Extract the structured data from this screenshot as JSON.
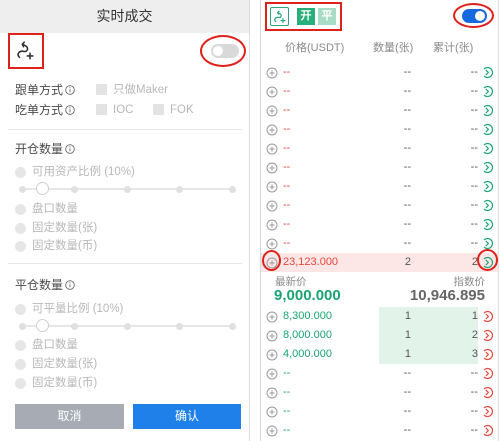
{
  "colors": {
    "accent": "#1e80e8",
    "buy": "#1aa471",
    "sell": "#e8463c",
    "annotation": "#e0201a"
  },
  "left_panel": {
    "title": "实时成交",
    "follow_icon": "follow-trade-icon",
    "follow_toggle_on": false,
    "follow_mode": {
      "label": "跟单方式",
      "option": "只做Maker"
    },
    "take_mode": {
      "label": "吃单方式",
      "options": [
        "IOC",
        "FOK"
      ]
    },
    "open_qty": {
      "title": "开仓数量",
      "ratio_label": "可用资产比例 (10%)",
      "slider_percent": 10,
      "options": [
        "盘口数量",
        "固定数量(张)",
        "固定数量(币)"
      ]
    },
    "close_qty": {
      "title": "平仓数量",
      "ratio_label": "可平量比例 (10%)",
      "slider_percent": 10,
      "options": [
        "盘口数量",
        "固定数量(张)",
        "固定数量(币)"
      ]
    },
    "buttons": {
      "cancel": "取消",
      "confirm": "确认"
    }
  },
  "right_panel": {
    "follow_icon": "follow-trade-icon",
    "open_label": "开",
    "close_label": "平",
    "toggle_on": true,
    "columns": {
      "price": "价格(USDT)",
      "qty": "数量(张)",
      "total": "累计(张)"
    },
    "asks": [
      {
        "price": "--",
        "qty": "--",
        "total": "--"
      },
      {
        "price": "--",
        "qty": "--",
        "total": "--"
      },
      {
        "price": "--",
        "qty": "--",
        "total": "--"
      },
      {
        "price": "--",
        "qty": "--",
        "total": "--"
      },
      {
        "price": "--",
        "qty": "--",
        "total": "--"
      },
      {
        "price": "--",
        "qty": "--",
        "total": "--"
      },
      {
        "price": "--",
        "qty": "--",
        "total": "--"
      },
      {
        "price": "--",
        "qty": "--",
        "total": "--"
      },
      {
        "price": "--",
        "qty": "--",
        "total": "--"
      },
      {
        "price": "--",
        "qty": "--",
        "total": "--"
      },
      {
        "price": "23,123.000",
        "qty": "2",
        "total": "2"
      }
    ],
    "last_price": {
      "label": "最新价",
      "value": "9,000.000"
    },
    "index_price": {
      "label": "指数价",
      "value": "10,946.895"
    },
    "bids": [
      {
        "price": "8,300.000",
        "qty": "1",
        "total": "1"
      },
      {
        "price": "8,000.000",
        "qty": "1",
        "total": "2"
      },
      {
        "price": "4,000.000",
        "qty": "1",
        "total": "3"
      },
      {
        "price": "--",
        "qty": "--",
        "total": "--"
      },
      {
        "price": "--",
        "qty": "--",
        "total": "--"
      },
      {
        "price": "--",
        "qty": "--",
        "total": "--"
      },
      {
        "price": "--",
        "qty": "--",
        "total": "--"
      }
    ]
  }
}
